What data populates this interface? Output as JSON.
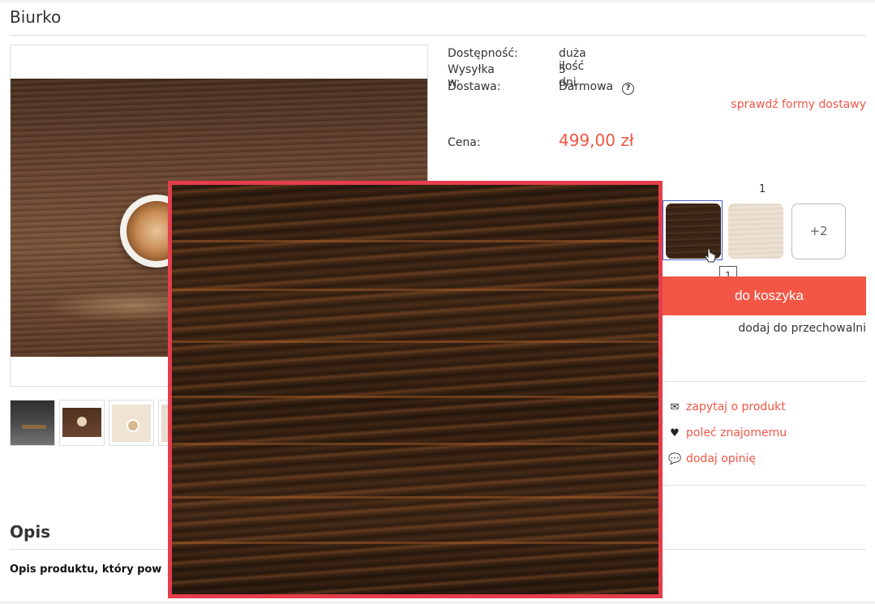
{
  "product": {
    "title": "Biurko"
  },
  "info": {
    "availability_label": "Dostępność:",
    "availability_value": "duża ilość",
    "shipping_label": "Wysyłka w:",
    "shipping_value": "5 dni",
    "delivery_label": "Dostawa:",
    "delivery_value": "Darmowa",
    "help_glyph": "?",
    "delivery_link": "sprawdź formy dostawy",
    "price_label": "Cena:",
    "price_value": "499,00 zł"
  },
  "variants": {
    "count_label": "1",
    "more_label": "+2",
    "tooltip": "1",
    "swatches": [
      "dark-wood",
      "light-wood"
    ]
  },
  "cart": {
    "button_label": "do koszyka",
    "storage_link": "dodaj do przechowalni"
  },
  "actions": [
    {
      "icon": "envelope-icon",
      "glyph": "✉",
      "label": "zapytaj o produkt"
    },
    {
      "icon": "heart-icon",
      "glyph": "♥",
      "label": "poleć znajomemu"
    },
    {
      "icon": "chat-icon",
      "glyph": "💬",
      "label": "dodaj opinię"
    }
  ],
  "description": {
    "title": "Opis",
    "text": "Opis produktu, który pow"
  },
  "colors": {
    "accent": "#f35645",
    "zoom_border": "#e43e4c",
    "selected_border": "#4a64c8"
  }
}
